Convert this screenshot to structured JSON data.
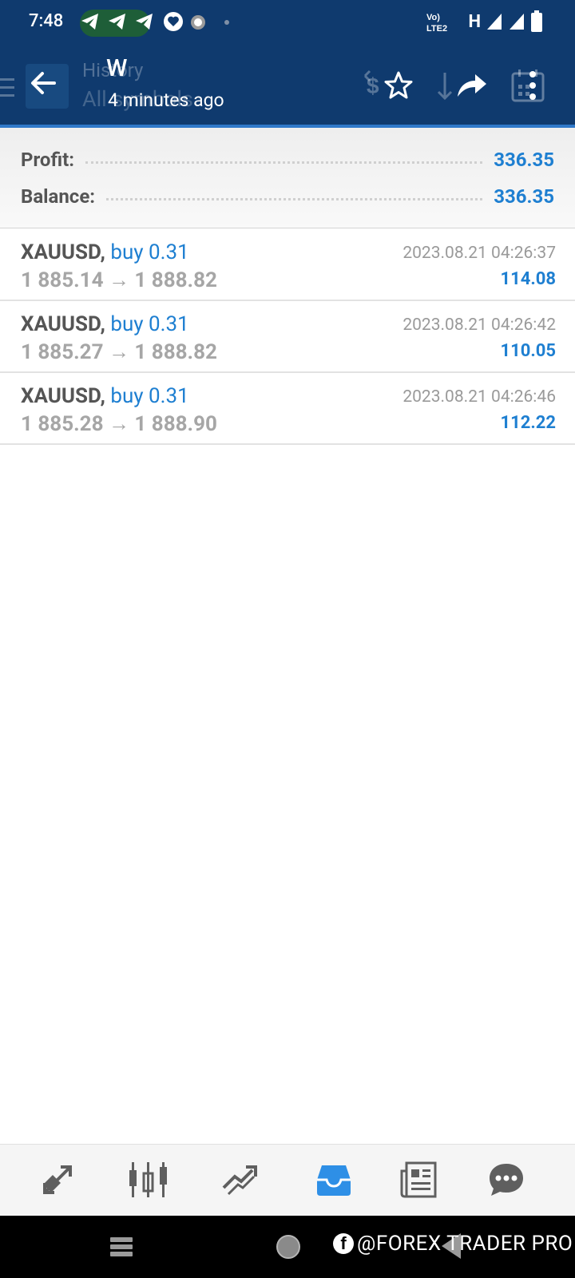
{
  "status_bar": {
    "time": "7:48",
    "network": "H"
  },
  "header": {
    "title": "W",
    "subtitle": "4 minutes ago",
    "ghost_title": "History",
    "ghost_subtitle": "All symbols"
  },
  "summary": {
    "profit_label": "Profit:",
    "profit_value": "336.35",
    "balance_label": "Balance:",
    "balance_value": "336.35"
  },
  "deals": [
    {
      "symbol": "XAUUSD,",
      "type": "buy 0.31",
      "prices": "1 885.14 → 1 888.82",
      "time": "2023.08.21 04:26:37",
      "profit": "114.08"
    },
    {
      "symbol": "XAUUSD,",
      "type": "buy 0.31",
      "prices": "1 885.27 → 1 888.82",
      "time": "2023.08.21 04:26:42",
      "profit": "110.05"
    },
    {
      "symbol": "XAUUSD,",
      "type": "buy 0.31",
      "prices": "1 885.28 → 1 888.90",
      "time": "2023.08.21 04:26:46",
      "profit": "112.22"
    }
  ],
  "tabs": [
    {
      "icon": "quotes-icon",
      "active": false
    },
    {
      "icon": "chart-icon",
      "active": false
    },
    {
      "icon": "trade-icon",
      "active": false
    },
    {
      "icon": "history-icon",
      "active": true
    },
    {
      "icon": "news-icon",
      "active": false
    },
    {
      "icon": "messages-icon",
      "active": false
    }
  ],
  "watermark": {
    "text": "@FOREX TRADER PRO"
  },
  "colors": {
    "header_bg": "#0f3a6e",
    "accent": "#1e7fd1",
    "active_tab": "#2e8fe6",
    "inactive_tab": "#5f5f5f"
  }
}
